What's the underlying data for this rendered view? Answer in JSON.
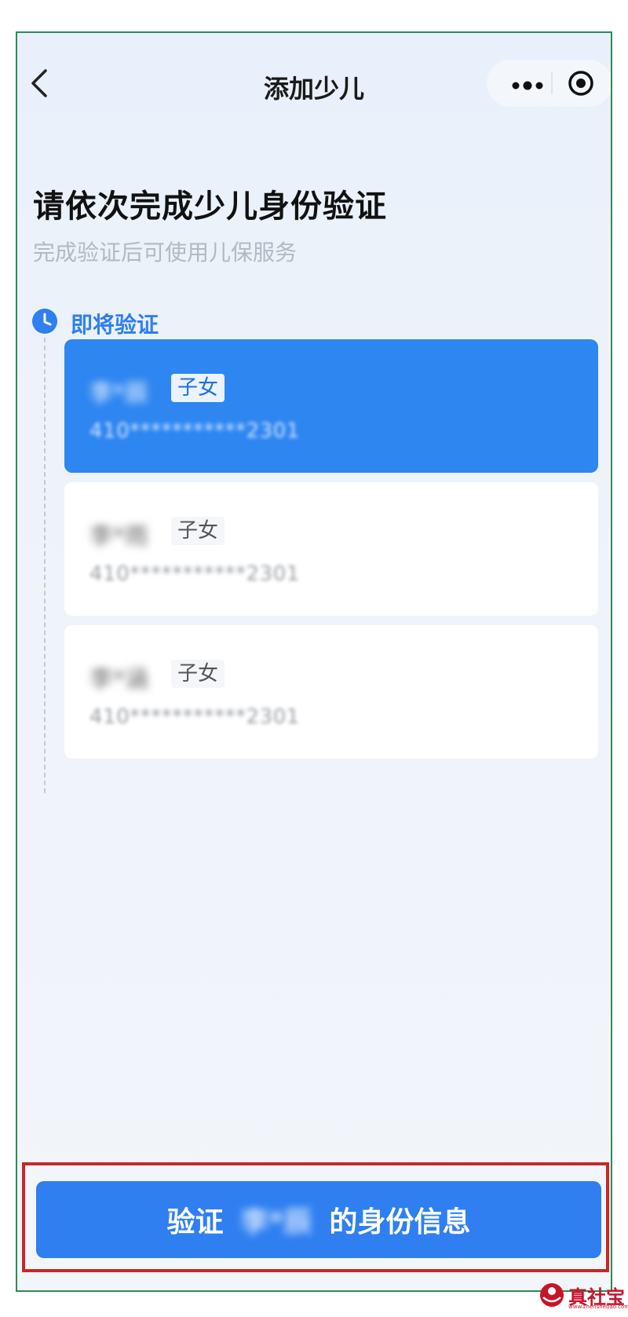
{
  "nav": {
    "title": "添加少儿",
    "back_icon": "chevron-left-icon",
    "more_icon": "more-dots-icon",
    "close_icon": "target-circle-icon"
  },
  "header": {
    "title": "请依次完成少儿身份验证",
    "subtitle": "完成验证后可使用儿保服务"
  },
  "timeline": {
    "status": "即将验证",
    "icon": "clock-icon",
    "accent": "#2f7ff1"
  },
  "children": [
    {
      "name": "李*辰",
      "relation": "子女",
      "id": "410***********2301",
      "active": true
    },
    {
      "name": "李*雨",
      "relation": "子女",
      "id": "410***********2301",
      "active": false
    },
    {
      "name": "李*涵",
      "relation": "子女",
      "id": "410***********2301",
      "active": false
    }
  ],
  "verify_button": {
    "prefix": "验证",
    "name": "李*辰",
    "suffix": "的身份信息"
  },
  "watermark": {
    "text": "真社宝",
    "small": "www.zhenshebao.com",
    "color": "#c8142b"
  }
}
